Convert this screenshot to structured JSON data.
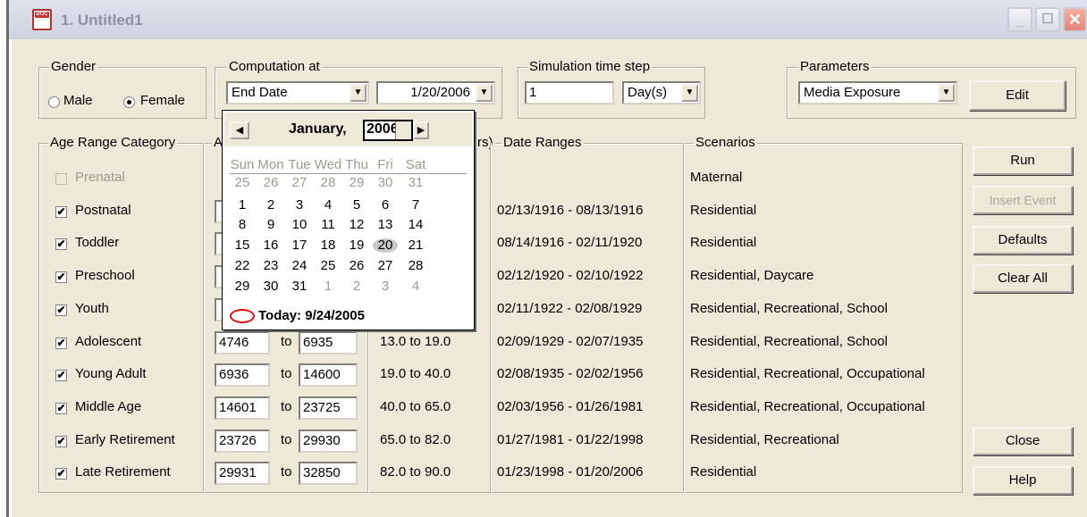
{
  "window": {
    "title": "1. Untitled1",
    "icon_tag": "DOC"
  },
  "gender": {
    "legend": "Gender",
    "male_label": "Male",
    "female_label": "Female",
    "selected": "Female"
  },
  "computation": {
    "legend": "Computation at",
    "mode": "End Date",
    "date": "1/20/2006"
  },
  "simulation": {
    "legend": "Simulation time step",
    "value": "1",
    "unit": "Day(s)"
  },
  "parameters": {
    "legend": "Parameters",
    "selected": "Media Exposure",
    "edit_label": "Edit"
  },
  "table": {
    "age_range_legend": "Age Range Category",
    "age_days_legend": "A",
    "age_years_legend": "rs)",
    "date_ranges_legend": "Date Ranges",
    "scenarios_legend": "Scenarios",
    "to_label": "to",
    "rows": [
      {
        "name": "Prenatal",
        "checked": false,
        "enabled": false,
        "from": "",
        "to": "",
        "years": "",
        "dates": "",
        "scenarios": "Maternal"
      },
      {
        "name": "Postnatal",
        "checked": true,
        "enabled": true,
        "from": "",
        "to": "",
        "years": "",
        "dates": "02/13/1916 - 08/13/1916",
        "scenarios": "Residential"
      },
      {
        "name": "Toddler",
        "checked": true,
        "enabled": true,
        "from": "",
        "to": "",
        "years": "",
        "dates": "08/14/1916 - 02/11/1920",
        "scenarios": "Residential"
      },
      {
        "name": "Preschool",
        "checked": true,
        "enabled": true,
        "from": "",
        "to": "",
        "years": "",
        "dates": "02/12/1920 - 02/10/1922",
        "scenarios": "Residential, Daycare"
      },
      {
        "name": "Youth",
        "checked": true,
        "enabled": true,
        "from": "",
        "to": "",
        "years": "",
        "dates": "02/11/1922 - 02/08/1929",
        "scenarios": "Residential, Recreational, School"
      },
      {
        "name": "Adolescent",
        "checked": true,
        "enabled": true,
        "from": "4746",
        "to": "6935",
        "years": "13.0 to 19.0",
        "dates": "02/09/1929 - 02/07/1935",
        "scenarios": "Residential, Recreational, School"
      },
      {
        "name": "Young Adult",
        "checked": true,
        "enabled": true,
        "from": "6936",
        "to": "14600",
        "years": "19.0 to 40.0",
        "dates": "02/08/1935 - 02/02/1956",
        "scenarios": "Residential, Recreational, Occupational"
      },
      {
        "name": "Middle Age",
        "checked": true,
        "enabled": true,
        "from": "14601",
        "to": "23725",
        "years": "40.0 to 65.0",
        "dates": "02/03/1956 - 01/26/1981",
        "scenarios": "Residential, Recreational, Occupational"
      },
      {
        "name": "Early Retirement",
        "checked": true,
        "enabled": true,
        "from": "23726",
        "to": "29930",
        "years": "65.0 to 82.0",
        "dates": "01/27/1981 - 01/22/1998",
        "scenarios": "Residential, Recreational"
      },
      {
        "name": "Late Retirement",
        "checked": true,
        "enabled": true,
        "from": "29931",
        "to": "32850",
        "years": "82.0 to 90.0",
        "dates": "01/23/1998 - 01/20/2006",
        "scenarios": "Residential"
      }
    ]
  },
  "buttons": {
    "run": "Run",
    "insert_event": "Insert Event",
    "defaults": "Defaults",
    "clear_all": "Clear All",
    "close": "Close",
    "help": "Help"
  },
  "calendar": {
    "month": "January,",
    "year": "2006",
    "weekdays": [
      "Sun",
      "Mon",
      "Tue",
      "Wed",
      "Thu",
      "Fri",
      "Sat"
    ],
    "weeks": [
      [
        "25",
        "26",
        "27",
        "28",
        "29",
        "30",
        "31"
      ],
      [
        "1",
        "2",
        "3",
        "4",
        "5",
        "6",
        "7"
      ],
      [
        "8",
        "9",
        "10",
        "11",
        "12",
        "13",
        "14"
      ],
      [
        "15",
        "16",
        "17",
        "18",
        "19",
        "20",
        "21"
      ],
      [
        "22",
        "23",
        "24",
        "25",
        "26",
        "27",
        "28"
      ],
      [
        "29",
        "30",
        "31",
        "1",
        "2",
        "3",
        "4"
      ]
    ],
    "selected_day": "20",
    "today_label": "Today: 9/24/2005"
  }
}
